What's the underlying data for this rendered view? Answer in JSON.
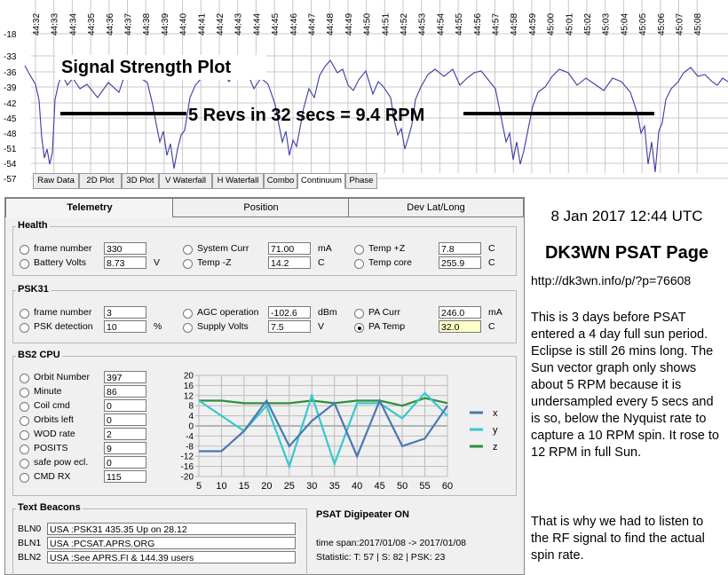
{
  "signal_plot": {
    "title": "Signal Strength Plot",
    "annotation": "5 Revs in 32 secs = 9.4 RPM",
    "time_labels": [
      "44:32",
      "44:33",
      "44:34",
      "44:35",
      "44:36",
      "44:37",
      "44:38",
      "44:39",
      "44:40",
      "44:41",
      "44:42",
      "44:43",
      "44:44",
      "44:45",
      "44:46",
      "44:47",
      "44:48",
      "44:49",
      "44:50",
      "44:51",
      "44:52",
      "44:53",
      "44:54",
      "44:55",
      "44:56",
      "44:57",
      "44:58",
      "44:59",
      "45:00",
      "45:01",
      "45:02",
      "45:03",
      "45:04",
      "45:05",
      "45:06",
      "45:07",
      "45:08"
    ],
    "y_labels": [
      "-18",
      "-33",
      "-36",
      "-39",
      "-42",
      "-45",
      "-48",
      "-51",
      "-54",
      "-57"
    ],
    "line_color": "#3c3ca0"
  },
  "bottom_tabs": [
    "Raw Data",
    "2D Plot",
    "3D Plot",
    "V Waterfall",
    "H Waterfall",
    "Combo",
    "Continuum",
    "Phase"
  ],
  "bottom_tabs_active": "Continuum",
  "panel_tabs": [
    "Telemetry",
    "Position",
    "Dev Lat/Long"
  ],
  "health": {
    "title": "Health",
    "col1": [
      {
        "label": "frame number",
        "value": "330"
      },
      {
        "label": "Battery Volts",
        "value": "8.73",
        "unit": "V"
      }
    ],
    "col2": [
      {
        "label": "System Curr",
        "value": "71.00",
        "unit": "mA"
      },
      {
        "label": "Temp -Z",
        "value": "14.2",
        "unit": "C"
      }
    ],
    "col3": [
      {
        "label": "Temp +Z",
        "value": "7.8",
        "unit": "C"
      },
      {
        "label": "Temp core",
        "value": "255.9",
        "unit": "C"
      }
    ]
  },
  "psk31": {
    "title": "PSK31",
    "col1": [
      {
        "label": "frame number",
        "value": "3"
      },
      {
        "label": "PSK detection",
        "value": "10",
        "unit": "%"
      }
    ],
    "col2": [
      {
        "label": "AGC operation",
        "value": "-102.6",
        "unit": "dBm"
      },
      {
        "label": "Supply Volts",
        "value": "7.5",
        "unit": "V"
      }
    ],
    "col3": [
      {
        "label": "PA Curr",
        "value": "246.0",
        "unit": "mA"
      },
      {
        "label": "PA Temp",
        "value": "32.0",
        "unit": "C"
      }
    ]
  },
  "bs2": {
    "title": "BS2 CPU",
    "items": [
      {
        "label": "Orbit Number",
        "value": "397"
      },
      {
        "label": "Minute",
        "value": "86"
      },
      {
        "label": "Coil cmd",
        "value": "0"
      },
      {
        "label": "Orbits left",
        "value": "0"
      },
      {
        "label": "WOD rate",
        "value": "2"
      },
      {
        "label": "POSITS",
        "value": "9"
      },
      {
        "label": "safe pow ecl.",
        "value": "0"
      },
      {
        "label": "CMD RX",
        "value": "115"
      }
    ]
  },
  "chart_data": {
    "type": "line",
    "x": [
      5,
      10,
      15,
      20,
      25,
      30,
      35,
      40,
      45,
      50,
      55,
      60
    ],
    "x_ticks": [
      "5",
      "10",
      "15",
      "20",
      "25",
      "30",
      "35",
      "40",
      "45",
      "50",
      "55",
      "60"
    ],
    "y_ticks": [
      "20",
      "16",
      "12",
      "8",
      "4",
      "0",
      "-4",
      "-8",
      "-12",
      "-16",
      "-20"
    ],
    "ylim": [
      -20,
      20
    ],
    "series": [
      {
        "name": "x",
        "color": "#4a78b0",
        "values": [
          -10,
          -10,
          -2,
          10,
          -8,
          2,
          9,
          -12,
          10,
          -8,
          -5,
          8
        ]
      },
      {
        "name": "y",
        "color": "#36c8d0",
        "values": [
          10,
          4,
          -2,
          8,
          -16,
          12,
          -15,
          9,
          9,
          3,
          13,
          4
        ]
      },
      {
        "name": "z",
        "color": "#2f8f3a",
        "values": [
          10,
          10,
          9,
          9,
          9,
          10,
          9,
          10,
          10,
          8,
          11,
          9
        ]
      }
    ]
  },
  "text_beacons": {
    "title": "Text Beacons",
    "rows": [
      {
        "label": "BLN0",
        "value": "USA :PSK31 435.35 Up on 28.12"
      },
      {
        "label": "BLN1",
        "value": "USA :PCSAT.APRS.ORG"
      },
      {
        "label": "BLN2",
        "value": "USA :See APRS.FI & 144.39 users"
      }
    ]
  },
  "digipeater": "PSAT  Digipeater ON",
  "time_span": "time span:2017/01/08 -> 2017/01/08",
  "statistic": "Statistic:     T: 57 | S: 82 | PSK: 23",
  "right": {
    "datetime": "8 Jan 2017 12:44 UTC",
    "page_title": "DK3WN PSAT Page",
    "url": "http://dk3wn.info/p/?p=76608",
    "para1": "This is 3 days before PSAT entered a 4 day full sun period. Eclipse is still 26 mins long. The Sun vector graph only shows about 5 RPM because it is undersampled every 5 secs and is so, below the Nyquist rate to capture a 10 RPM spin.  It rose to 12 RPM in full Sun.",
    "para2": "That is why we had to listen to the RF signal to find the actual spin rate."
  }
}
